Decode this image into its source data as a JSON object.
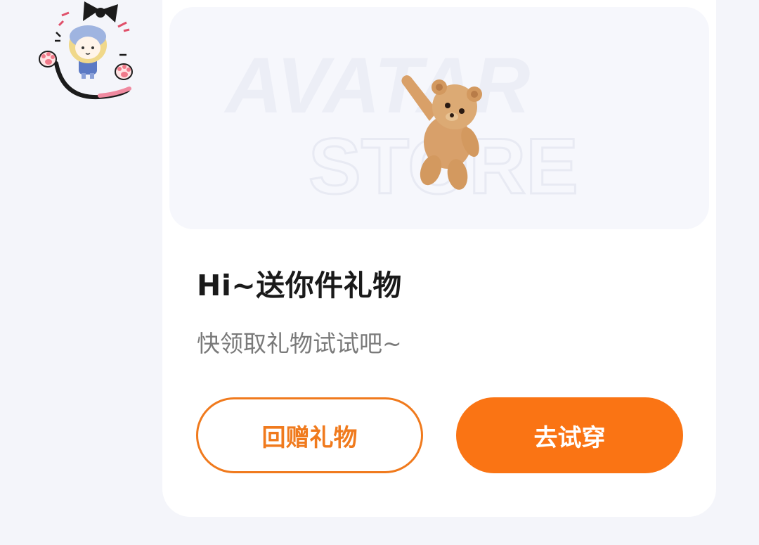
{
  "banner": {
    "watermark_line1": "AVATAR",
    "watermark_line2": "STORE",
    "image": "teddy-bear-gift"
  },
  "gift_card": {
    "title": "Hi~送你件礼物",
    "subtitle": "快领取礼物试试吧~"
  },
  "actions": {
    "return_gift_label": "回赠礼物",
    "try_on_label": "去试穿"
  },
  "colors": {
    "accent": "#fa7414",
    "outline": "#f07a1d",
    "background": "#f4f5fa",
    "card": "#ffffff",
    "title": "#1a1a1a",
    "subtitle": "#7a7a7a"
  }
}
